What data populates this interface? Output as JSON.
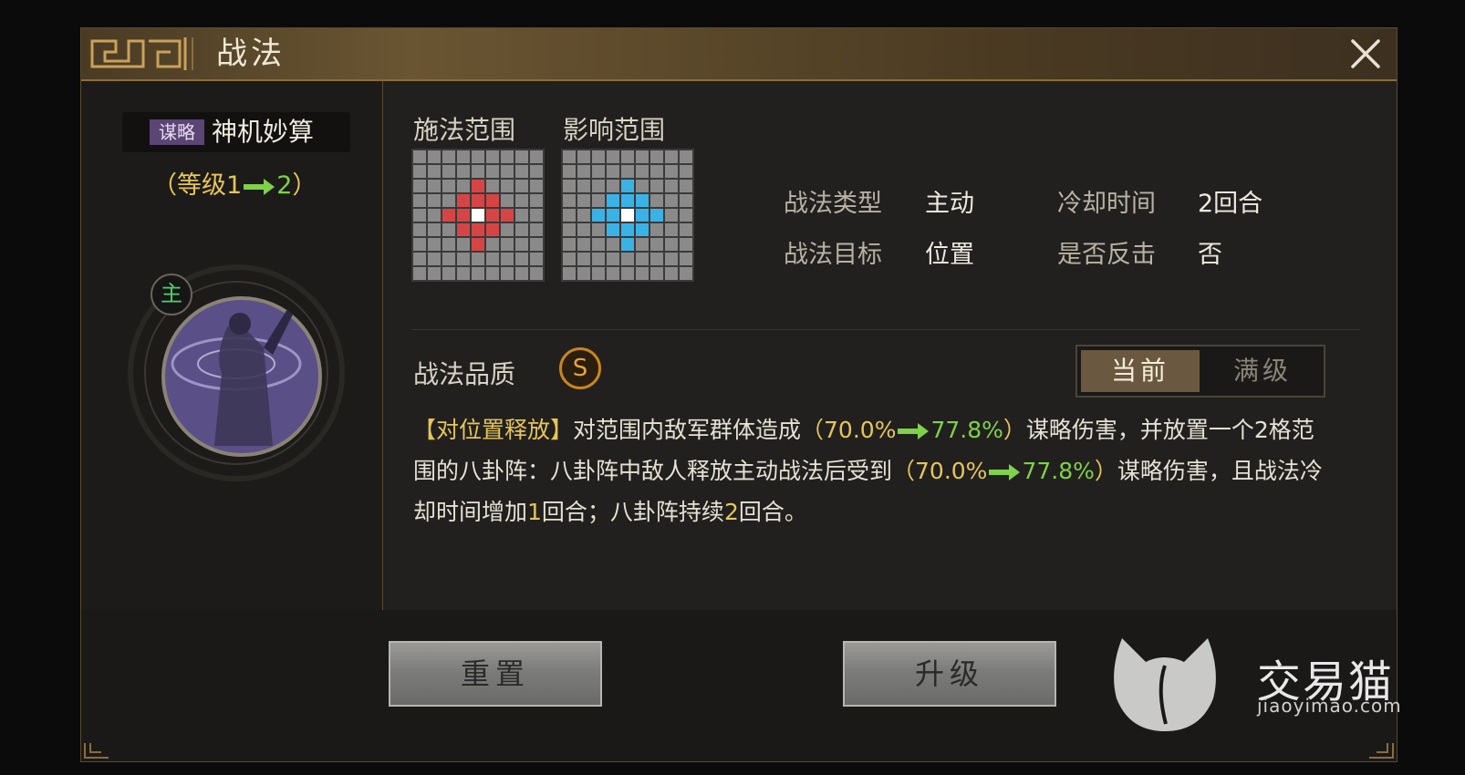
{
  "window": {
    "title": "战法"
  },
  "skill": {
    "tag": "谋略",
    "name": "神机妙算",
    "level_prefix": "（等级1",
    "level_to": "2",
    "level_suffix": "）",
    "portrait_badge": "主"
  },
  "range": {
    "cast_label": "施法范围",
    "effect_label": "影响范围",
    "cast_color": "#d64545",
    "effect_color": "#3bb2e6",
    "center_color": "#ffffff"
  },
  "info": {
    "type_label": "战法类型",
    "type_value": "主动",
    "cooldown_label": "冷却时间",
    "cooldown_value": "2回合",
    "target_label": "战法目标",
    "target_value": "位置",
    "counter_label": "是否反击",
    "counter_value": "否"
  },
  "quality": {
    "label": "战法品质",
    "grade": "S"
  },
  "toggle": {
    "current": "当前",
    "max": "满级"
  },
  "description": {
    "tag": "【对位置释放】",
    "p1": "对范围内敌军群体造成",
    "v1_open": "（70.0%",
    "v1_new": "77.8%",
    "v1_close": "）",
    "p2": "谋略伤害，并放置一个2格范围的八卦阵：八卦阵中敌人释放主动战法后受到",
    "v2_open": "（70.0%",
    "v2_new": "77.8%",
    "v2_close": "）",
    "p3": "谋略伤害，且战法冷却时间增加",
    "n1": "1",
    "p4": "回合；八卦阵持续",
    "n2": "2",
    "p5": "回合。"
  },
  "buttons": {
    "reset": "重置",
    "upgrade": "升级"
  },
  "watermark": {
    "name": "交易猫",
    "url": "jiaoyimao.com"
  }
}
